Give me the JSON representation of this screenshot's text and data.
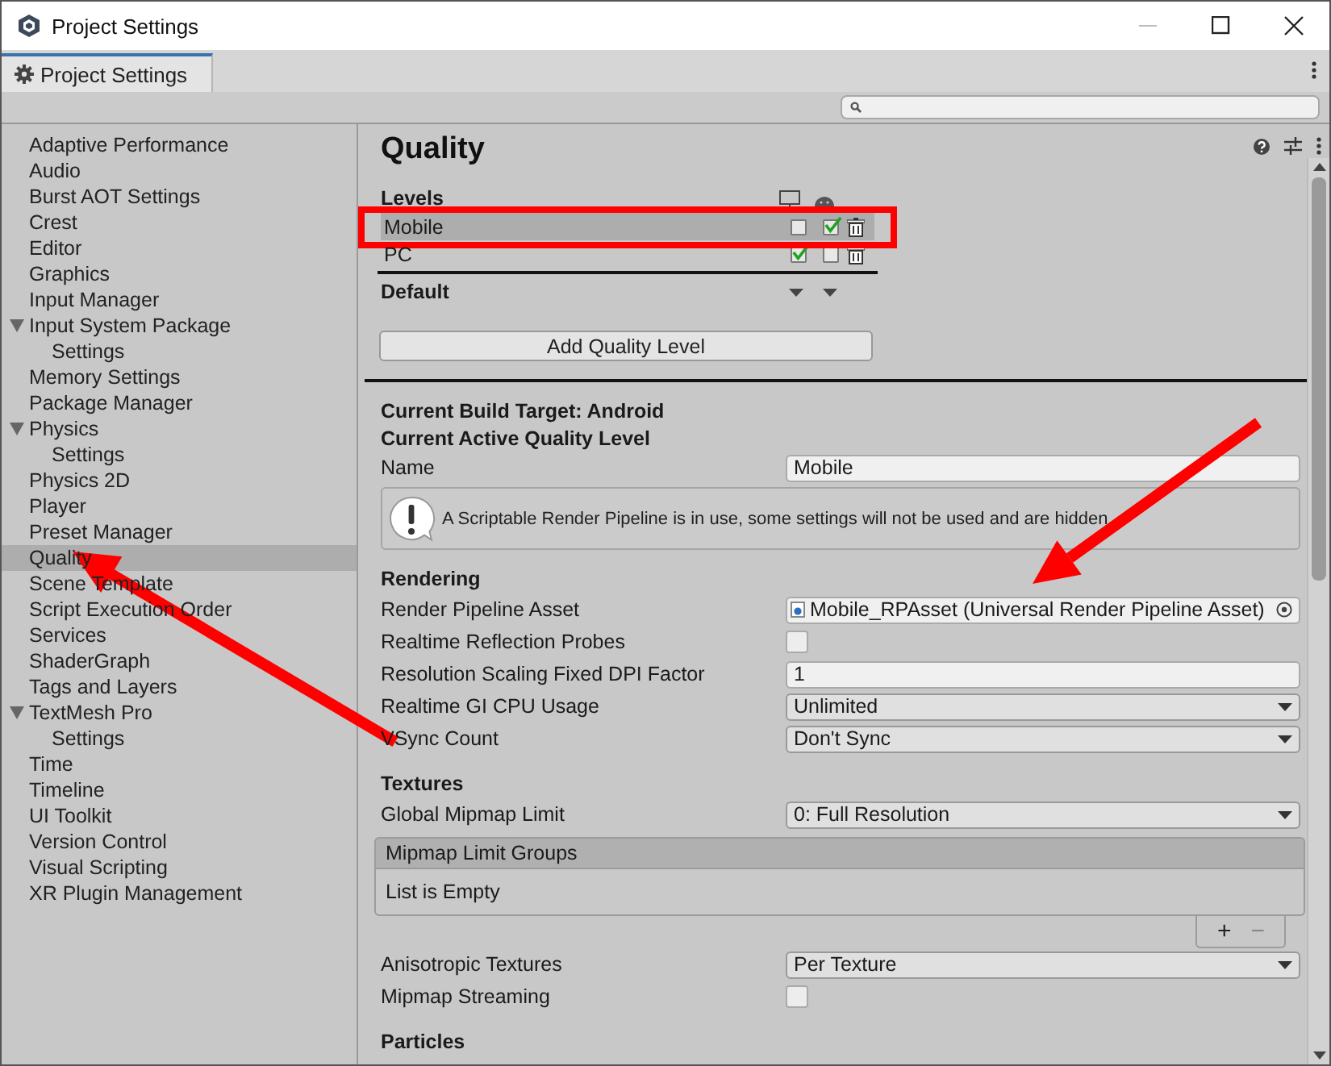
{
  "window": {
    "title": "Project Settings"
  },
  "tab": {
    "label": "Project Settings",
    "selected": true
  },
  "sidebar": {
    "items": [
      {
        "label": "Adaptive Performance",
        "selected": false
      },
      {
        "label": "Audio",
        "selected": false
      },
      {
        "label": "Burst AOT Settings",
        "selected": false
      },
      {
        "label": "Crest",
        "selected": false
      },
      {
        "label": "Editor",
        "selected": false
      },
      {
        "label": "Graphics",
        "selected": false
      },
      {
        "label": "Input Manager",
        "selected": false
      },
      {
        "label": "Input System Package",
        "selected": false,
        "expanded": true,
        "children": [
          {
            "label": "Settings",
            "selected": false
          }
        ]
      },
      {
        "label": "Memory Settings",
        "selected": false
      },
      {
        "label": "Package Manager",
        "selected": false
      },
      {
        "label": "Physics",
        "selected": false,
        "expanded": true,
        "children": [
          {
            "label": "Settings",
            "selected": false
          }
        ]
      },
      {
        "label": "Physics 2D",
        "selected": false
      },
      {
        "label": "Player",
        "selected": false
      },
      {
        "label": "Preset Manager",
        "selected": false
      },
      {
        "label": "Quality",
        "selected": true
      },
      {
        "label": "Scene Template",
        "selected": false
      },
      {
        "label": "Script Execution Order",
        "selected": false
      },
      {
        "label": "Services",
        "selected": false
      },
      {
        "label": "ShaderGraph",
        "selected": false
      },
      {
        "label": "Tags and Layers",
        "selected": false
      },
      {
        "label": "TextMesh Pro",
        "selected": false,
        "expanded": true,
        "children": [
          {
            "label": "Settings",
            "selected": false
          }
        ]
      },
      {
        "label": "Time",
        "selected": false
      },
      {
        "label": "Timeline",
        "selected": false
      },
      {
        "label": "UI Toolkit",
        "selected": false
      },
      {
        "label": "Version Control",
        "selected": false
      },
      {
        "label": "Visual Scripting",
        "selected": false
      },
      {
        "label": "XR Plugin Management",
        "selected": false
      }
    ]
  },
  "inspector": {
    "title": "Quality",
    "levels": {
      "heading": "Levels",
      "rows": [
        {
          "name": "Mobile",
          "selected": true,
          "platforms": [
            false,
            true
          ]
        },
        {
          "name": "PC",
          "selected": false,
          "platforms": [
            true,
            false
          ]
        }
      ],
      "default_label": "Default",
      "add_button": "Add Quality Level"
    },
    "build_target": "Current Build Target: Android",
    "active_level": "Current Active Quality Level",
    "name_field": {
      "label": "Name",
      "value": "Mobile"
    },
    "help_box": "A Scriptable Render Pipeline is in use, some settings will not be used and are hidden",
    "sections": [
      {
        "heading": "Rendering",
        "rows": [
          {
            "kind": "object",
            "label": "Render Pipeline Asset",
            "value": "Mobile_RPAsset (Universal Render Pipeline Asset)"
          },
          {
            "kind": "checkbox",
            "label": "Realtime Reflection Probes",
            "checked": false
          },
          {
            "kind": "text",
            "label": "Resolution Scaling Fixed DPI Factor",
            "value": "1"
          },
          {
            "kind": "dropdown",
            "label": "Realtime GI CPU Usage",
            "value": "Unlimited"
          },
          {
            "kind": "dropdown",
            "label": "VSync Count",
            "value": "Don't Sync"
          }
        ]
      },
      {
        "heading": "Textures",
        "rows": [
          {
            "kind": "dropdown",
            "label": "Global Mipmap Limit",
            "value": "0: Full Resolution"
          },
          {
            "kind": "list",
            "label": "Mipmap Limit Groups",
            "empty_text": "List is Empty",
            "add": "+",
            "remove": "−"
          },
          {
            "kind": "dropdown",
            "label": "Anisotropic Textures",
            "value": "Per Texture"
          },
          {
            "kind": "checkbox",
            "label": "Mipmap Streaming",
            "checked": false
          }
        ]
      },
      {
        "heading": "Particles"
      }
    ]
  }
}
